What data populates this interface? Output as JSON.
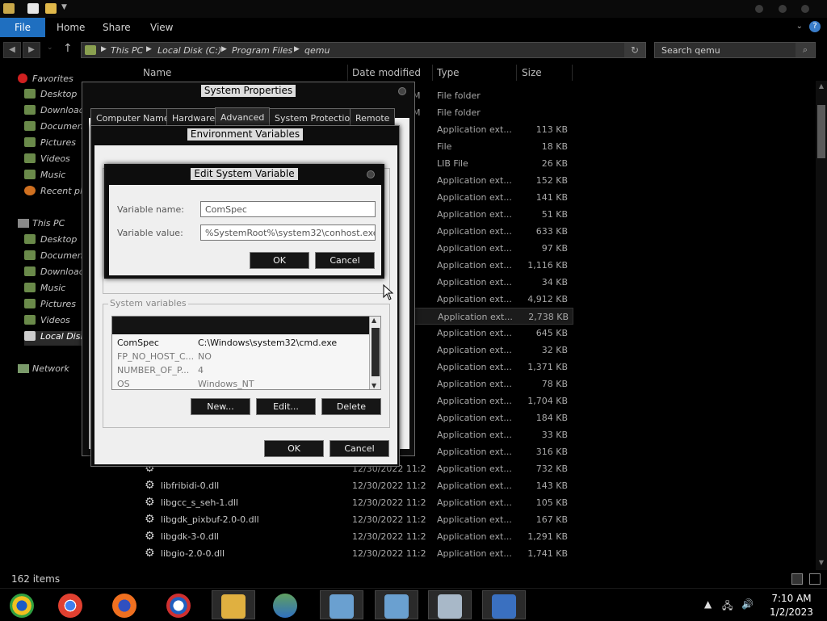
{
  "window": {
    "quick_access_icons": [
      "folder-icon",
      "properties-icon",
      "new-folder-icon",
      "dropdown-icon"
    ]
  },
  "ribbon": {
    "file": "File",
    "tabs": [
      "Home",
      "Share",
      "View"
    ],
    "help_icon": "?"
  },
  "address": {
    "crumbs": [
      "This PC",
      "Local Disk (C:)",
      "Program Files",
      "qemu"
    ],
    "search_placeholder": "Search qemu"
  },
  "nav": {
    "favorites_label": "Favorites",
    "favorites": [
      "Desktop",
      "Downloads",
      "Documents",
      "Pictures",
      "Videos",
      "Music",
      "Recent places"
    ],
    "thispc_label": "This PC",
    "thispc": [
      "Desktop",
      "Documents",
      "Downloads",
      "Music",
      "Pictures",
      "Videos",
      "Local Disk (C:)"
    ],
    "network_label": "Network"
  },
  "columns": {
    "name": "Name",
    "date": "Date modified",
    "type": "Type",
    "size": "Size"
  },
  "files": [
    {
      "name": "",
      "date": "M",
      "type": "File folder",
      "size": ""
    },
    {
      "name": "",
      "date": "M",
      "type": "File folder",
      "size": ""
    },
    {
      "name": "",
      "date": "",
      "type": "Application ext...",
      "size": "113 KB"
    },
    {
      "name": "",
      "date": "",
      "type": "File",
      "size": "18 KB"
    },
    {
      "name": "",
      "date": "",
      "type": "LIB File",
      "size": "26 KB"
    },
    {
      "name": "",
      "date": "",
      "type": "Application ext...",
      "size": "152 KB"
    },
    {
      "name": "",
      "date": "",
      "type": "Application ext...",
      "size": "141 KB"
    },
    {
      "name": "",
      "date": "",
      "type": "Application ext...",
      "size": "51 KB"
    },
    {
      "name": "",
      "date": "",
      "type": "Application ext...",
      "size": "633 KB"
    },
    {
      "name": "",
      "date": "",
      "type": "Application ext...",
      "size": "97 KB"
    },
    {
      "name": "",
      "date": "",
      "type": "Application ext...",
      "size": "1,116 KB"
    },
    {
      "name": "",
      "date": "",
      "type": "Application ext...",
      "size": "34 KB"
    },
    {
      "name": "",
      "date": "",
      "type": "Application ext...",
      "size": "4,912 KB"
    },
    {
      "name": "",
      "date": "",
      "type": "Application ext...",
      "size": "2,738 KB"
    },
    {
      "name": "",
      "date": "",
      "type": "Application ext...",
      "size": "645 KB"
    },
    {
      "name": "",
      "date": "",
      "type": "Application ext...",
      "size": "32 KB"
    },
    {
      "name": "",
      "date": "",
      "type": "Application ext...",
      "size": "1,371 KB"
    },
    {
      "name": "",
      "date": "",
      "type": "Application ext...",
      "size": "78 KB"
    },
    {
      "name": "",
      "date": "",
      "type": "Application ext...",
      "size": "1,704 KB"
    },
    {
      "name": "",
      "date": "",
      "type": "Application ext...",
      "size": "184 KB"
    },
    {
      "name": "",
      "date": "",
      "type": "Application ext...",
      "size": "33 KB"
    },
    {
      "name": "",
      "date": "",
      "type": "Application ext...",
      "size": "316 KB"
    },
    {
      "name": "",
      "date": "12/30/2022 11:2...",
      "type": "Application ext...",
      "size": "732 KB"
    },
    {
      "name": "libfribidi-0.dll",
      "date": "12/30/2022 11:2...",
      "type": "Application ext...",
      "size": "143 KB"
    },
    {
      "name": "libgcc_s_seh-1.dll",
      "date": "12/30/2022 11:2...",
      "type": "Application ext...",
      "size": "105 KB"
    },
    {
      "name": "libgdk_pixbuf-2.0-0.dll",
      "date": "12/30/2022 11:2...",
      "type": "Application ext...",
      "size": "167 KB"
    },
    {
      "name": "libgdk-3-0.dll",
      "date": "12/30/2022 11:2...",
      "type": "Application ext...",
      "size": "1,291 KB"
    },
    {
      "name": "libgio-2.0-0.dll",
      "date": "12/30/2022 11:2...",
      "type": "Application ext...",
      "size": "1,741 KB"
    }
  ],
  "status": {
    "count": "162 items"
  },
  "sysprops": {
    "title": "System Properties",
    "tabs": [
      "Computer Name",
      "Hardware",
      "Advanced",
      "System Protection",
      "Remote"
    ]
  },
  "envvars": {
    "title": "Environment Variables",
    "system_group": "System variables",
    "rows": [
      {
        "name": "ComSpec",
        "value": "C:\\Windows\\system32\\cmd.exe"
      },
      {
        "name": "FP_NO_HOST_C...",
        "value": "NO"
      },
      {
        "name": "NUMBER_OF_P...",
        "value": "4"
      },
      {
        "name": "OS",
        "value": "Windows_NT"
      }
    ],
    "new": "New...",
    "edit": "Edit...",
    "delete": "Delete",
    "ok": "OK",
    "cancel": "Cancel"
  },
  "editvar": {
    "title": "Edit System Variable",
    "name_label": "Variable name:",
    "name_value": "ComSpec",
    "value_label": "Variable value:",
    "value_value": "%SystemRoot%\\system32\\conhost.exe",
    "ok": "OK",
    "cancel": "Cancel"
  },
  "taskbar": {
    "apps": [
      "chrome-dev",
      "chrome",
      "firefox",
      "obama-campaign",
      "file-explorer",
      "network-users",
      "vm-manager-1",
      "vm-manager-2",
      "performance-monitor",
      "remote-desktop"
    ],
    "time": "7:10 AM",
    "date": "1/2/2023"
  },
  "colors": {
    "accent": "#1f6fc0",
    "dialog_bg": "#efefef"
  }
}
